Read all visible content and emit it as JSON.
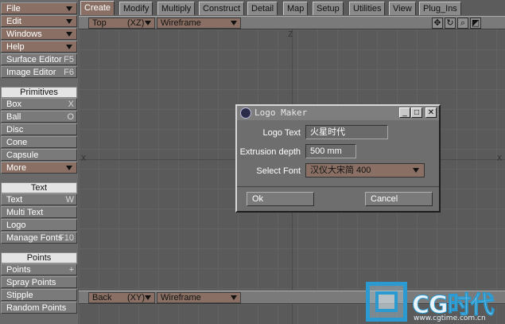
{
  "left_panel": {
    "menus": [
      {
        "label": "File"
      },
      {
        "label": "Edit"
      },
      {
        "label": "Windows"
      },
      {
        "label": "Help"
      }
    ],
    "editors": [
      {
        "label": "Surface Editor",
        "shortcut": "F5"
      },
      {
        "label": "Image Editor",
        "shortcut": "F6"
      }
    ],
    "primitives": {
      "header": "Primitives",
      "items": [
        {
          "label": "Box",
          "shortcut": "X"
        },
        {
          "label": "Ball",
          "shortcut": "O"
        },
        {
          "label": "Disc",
          "shortcut": ""
        },
        {
          "label": "Cone",
          "shortcut": ""
        },
        {
          "label": "Capsule",
          "shortcut": ""
        }
      ],
      "more": "More"
    },
    "text": {
      "header": "Text",
      "items": [
        {
          "label": "Text",
          "shortcut": "W"
        },
        {
          "label": "Multi Text",
          "shortcut": ""
        },
        {
          "label": "Logo",
          "shortcut": ""
        },
        {
          "label": "Manage Fonts",
          "shortcut": "F10"
        }
      ]
    },
    "points": {
      "header": "Points",
      "items": [
        {
          "label": "Points",
          "shortcut": "+"
        },
        {
          "label": "Spray Points",
          "shortcut": ""
        },
        {
          "label": "Stipple",
          "shortcut": ""
        },
        {
          "label": "Random Points",
          "shortcut": ""
        }
      ]
    }
  },
  "tabs": [
    "Create",
    "Modify",
    "Multiply",
    "Construct",
    "Detail",
    "Map",
    "Setup",
    "Utilities",
    "View",
    "Plug_Ins"
  ],
  "active_tab": "Create",
  "viewport_top": {
    "view": "Top",
    "axes": "(XZ)",
    "mode": "Wireframe",
    "axis_labels": {
      "top": "Z",
      "left": "X",
      "right": "X"
    }
  },
  "viewport_back": {
    "view": "Back",
    "axes": "(XY)",
    "mode": "Wireframe"
  },
  "dialog": {
    "title": "Logo Maker",
    "fields": {
      "logo_text_label": "Logo Text",
      "logo_text_value": "火星时代",
      "extrusion_label": "Extrusion depth",
      "extrusion_value": "500 mm",
      "font_label": "Select Font",
      "font_value": "汉仪大宋简 400"
    },
    "ok": "Ok",
    "cancel": "Cancel"
  },
  "watermark": {
    "brand": "CG时代",
    "url": "www.cgtime.com.cn"
  },
  "colors": {
    "accent_menu": "#8a7064",
    "panel_bg": "#6a6a6a",
    "viewport_bg": "#5a5a5a",
    "watermark_blue": "#2a9ad0"
  }
}
